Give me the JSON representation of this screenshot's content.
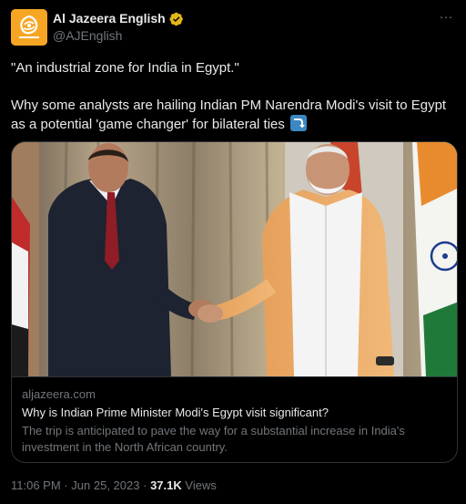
{
  "author": {
    "display_name": "Al Jazeera English",
    "handle": "@AJEnglish",
    "avatar_icon": "al-jazeera-logo",
    "verified_color": "#e2b719"
  },
  "more_icon_label": "···",
  "tweet": {
    "line1": "\"An industrial zone for India in Egypt.\"",
    "line2": "Why some analysts are hailing Indian PM Narendra Modi's visit to Egypt as a potential 'game changer' for bilateral ties",
    "emoji_icon": "right-arrow-curving-down-emoji"
  },
  "card": {
    "domain": "aljazeera.com",
    "title": "Why is Indian Prime Minister Modi's Egypt visit significant?",
    "description": "The trip is anticipated to pave the way for a substantial increase in India's investment in the North African country."
  },
  "meta": {
    "time": "11:06 PM",
    "separator": "·",
    "date": "Jun 25, 2023",
    "views_count": "37.1K",
    "views_label": "Views"
  },
  "colors": {
    "background": "#000000",
    "text": "#e7e9ea",
    "secondary_text": "#71767b",
    "border": "#2f3336",
    "avatar_bg": "#f6a623"
  }
}
